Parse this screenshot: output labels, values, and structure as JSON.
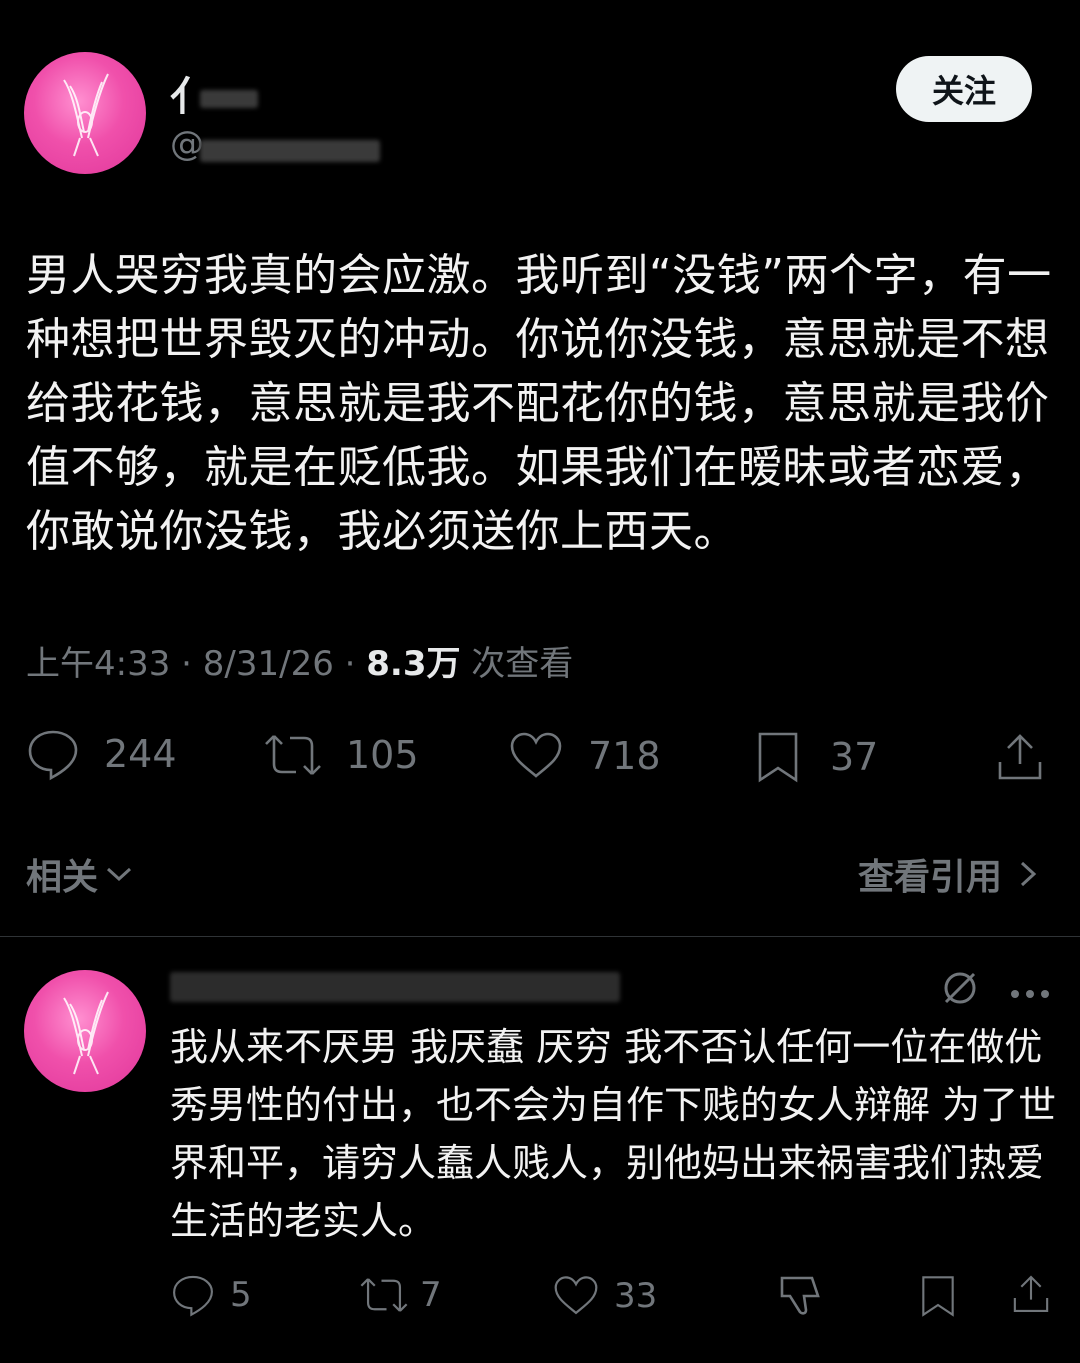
{
  "post": {
    "name_visible": "亻",
    "handle_visible": "@",
    "follow_label": "关注",
    "text": "男人哭穷我真的会应激。我听到“没钱”两个字，有一种想把世界毁灭的冲动。你说你没钱，意思就是不想给我花钱，意思就是我不配花你的钱，意思就是我价值不够，就是在贬低我。如果我们在暧昧或者恋爱，你敢说你没钱，我必须送你上西天。",
    "time": "上午4:33 · 8/31/26 · ",
    "views_count": "8.3万",
    "views_label": " 次查看",
    "stats": {
      "replies": "244",
      "reposts": "105",
      "likes": "718",
      "bookmarks": "37"
    },
    "related_label": "相关",
    "quotes_label": "查看引用"
  },
  "reply": {
    "text": "我从来不厌男 我厌蠢 厌穷 我不否认任何一位在做优秀男性的付出，也不会为自作下贱的女人辩解 为了世界和平，请穷人蠢人贱人，别他妈出来祸害我们热爱生活的老实人。",
    "stats": {
      "replies": "5",
      "reposts": "7",
      "likes": "33"
    }
  },
  "colors": {
    "background": "#000000",
    "text": "#f2f2f2",
    "muted": "#71767b",
    "avatar_pink": "#f050ab"
  }
}
